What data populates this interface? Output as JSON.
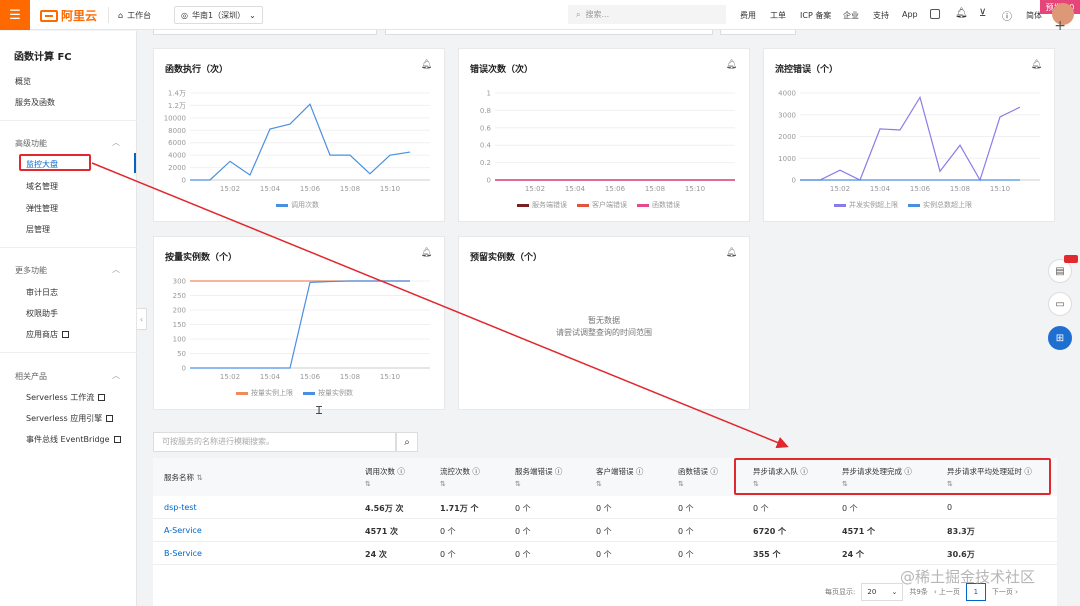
{
  "topbar": {
    "logo": "阿里云",
    "workbench": "工作台",
    "region": "华南1（深圳）",
    "search_placeholder": "搜索...",
    "links": [
      "费用",
      "工单",
      "ICP 备案",
      "企业",
      "支持",
      "App"
    ],
    "lang": "简体",
    "badge": "预发2.0"
  },
  "sidebar": {
    "title": "函数计算 FC",
    "items_top": [
      "概览",
      "服务及函数"
    ],
    "section_advanced": "高级功能",
    "advanced_items": [
      "监控大盘",
      "域名管理",
      "弹性管理",
      "层管理"
    ],
    "section_more": "更多功能",
    "more_items": [
      "审计日志",
      "权限助手",
      "应用商店"
    ],
    "section_related": "相关产品",
    "related_items": [
      "Serverless 工作流",
      "Serverless 应用引擎",
      "事件总线 EventBridge"
    ]
  },
  "colors": {
    "accent": "#ff6a00",
    "link": "#0064c8",
    "highlight": "#e0282e",
    "line_blue": "#4a90e2",
    "line_purple": "#8a7ce8",
    "line_orange": "#f08a5d"
  },
  "charts": {
    "invocations": {
      "title": "函数执行（次）",
      "legend": [
        "调用次数"
      ]
    },
    "errors": {
      "title": "错误次数（次）",
      "legend": [
        "服务端错误",
        "客户端错误",
        "函数错误"
      ]
    },
    "throttle": {
      "title": "流控错误（个）",
      "legend": [
        "并发实例超上限",
        "实例总数超上限"
      ]
    },
    "ondemand": {
      "title": "按量实例数（个）",
      "legend": [
        "按量实例上限",
        "按量实例数"
      ]
    },
    "provisioned": {
      "title": "预留实例数（个）",
      "nodata": "暂无数据",
      "nodata_hint": "请尝试调整查询的时间范围"
    }
  },
  "chart_data": [
    {
      "type": "line",
      "title": "函数执行（次）",
      "x": [
        "15:00",
        "15:01",
        "15:02",
        "15:03",
        "15:04",
        "15:05",
        "15:06",
        "15:07",
        "15:08",
        "15:09",
        "15:10",
        "15:11",
        "15:12"
      ],
      "xticks": [
        "15:02",
        "15:04",
        "15:06",
        "15:08",
        "15:10"
      ],
      "yticks": [
        "0",
        "2000",
        "4000",
        "6000",
        "8000",
        "10000",
        "1.2万",
        "1.4万"
      ],
      "ylim": [
        0,
        14000
      ],
      "series": [
        {
          "name": "调用次数",
          "values": [
            0,
            0,
            3000,
            800,
            8200,
            9000,
            12200,
            4000,
            4000,
            1000,
            4000,
            4500
          ]
        }
      ]
    },
    {
      "type": "line",
      "title": "错误次数（次）",
      "x": [
        "15:00",
        "15:12"
      ],
      "xticks": [
        "15:02",
        "15:04",
        "15:06",
        "15:08",
        "15:10"
      ],
      "yticks": [
        "0",
        "0.2",
        "0.4",
        "0.6",
        "0.8",
        "1"
      ],
      "ylim": [
        0,
        1
      ],
      "series": [
        {
          "name": "服务端错误",
          "values": [
            0,
            0
          ]
        },
        {
          "name": "客户端错误",
          "values": [
            0,
            0
          ]
        },
        {
          "name": "函数错误",
          "values": [
            0,
            0
          ]
        }
      ]
    },
    {
      "type": "line",
      "title": "流控错误（个）",
      "x": [
        "15:00",
        "15:01",
        "15:02",
        "15:03",
        "15:04",
        "15:05",
        "15:06",
        "15:07",
        "15:08",
        "15:09",
        "15:10",
        "15:11",
        "15:12"
      ],
      "xticks": [
        "15:02",
        "15:04",
        "15:06",
        "15:08",
        "15:10"
      ],
      "yticks": [
        "0",
        "1000",
        "2000",
        "3000",
        "4000"
      ],
      "ylim": [
        0,
        4000
      ],
      "series": [
        {
          "name": "并发实例超上限",
          "values": [
            0,
            0,
            450,
            0,
            2350,
            2300,
            3800,
            400,
            1600,
            0,
            2900,
            3350
          ]
        },
        {
          "name": "实例总数超上限",
          "values": [
            0,
            0,
            0,
            0,
            0,
            0,
            0,
            0,
            0,
            0,
            0,
            0
          ]
        }
      ]
    },
    {
      "type": "line",
      "title": "按量实例数（个）",
      "x": [
        "15:00",
        "15:01",
        "15:02",
        "15:03",
        "15:04",
        "15:05",
        "15:06",
        "15:07",
        "15:08",
        "15:09",
        "15:10",
        "15:11",
        "15:12"
      ],
      "xticks": [
        "15:02",
        "15:04",
        "15:06",
        "15:08",
        "15:10"
      ],
      "yticks": [
        "0",
        "50",
        "100",
        "150",
        "200",
        "250",
        "300"
      ],
      "ylim": [
        0,
        300
      ],
      "series": [
        {
          "name": "按量实例上限",
          "values": [
            300,
            300,
            300,
            300,
            300,
            300,
            300,
            300,
            300,
            300,
            300,
            300
          ]
        },
        {
          "name": "按量实例数",
          "values": [
            0,
            0,
            0,
            0,
            0,
            0,
            295,
            298,
            300,
            300,
            300,
            300
          ]
        }
      ]
    }
  ],
  "table": {
    "search_placeholder": "可按服务的名称进行模糊搜索。",
    "headers": [
      "服务名称",
      "调用次数",
      "流控次数",
      "服务端错误",
      "客户端错误",
      "函数错误",
      "异步请求入队",
      "异步请求处理完成",
      "异步请求平均处理延时"
    ],
    "rows": [
      [
        "dsp-test",
        "4.56万 次",
        "1.71万 个",
        "0 个",
        "0 个",
        "0 个",
        "0 个",
        "0 个",
        "0"
      ],
      [
        "A-Service",
        "4571 次",
        "0 个",
        "0 个",
        "0 个",
        "0 个",
        "6720 个",
        "4571 个",
        "83.3万"
      ],
      [
        "B-Service",
        "24 次",
        "0 个",
        "0 个",
        "0 个",
        "0 个",
        "355 个",
        "24 个",
        "30.6万"
      ]
    ]
  },
  "pager": {
    "page_size_label": "每页显示:",
    "page_size": "20",
    "total": "共9条",
    "prev": "上一页",
    "current": "1",
    "next": "下一页"
  },
  "watermark": "@稀土掘金技术社区"
}
